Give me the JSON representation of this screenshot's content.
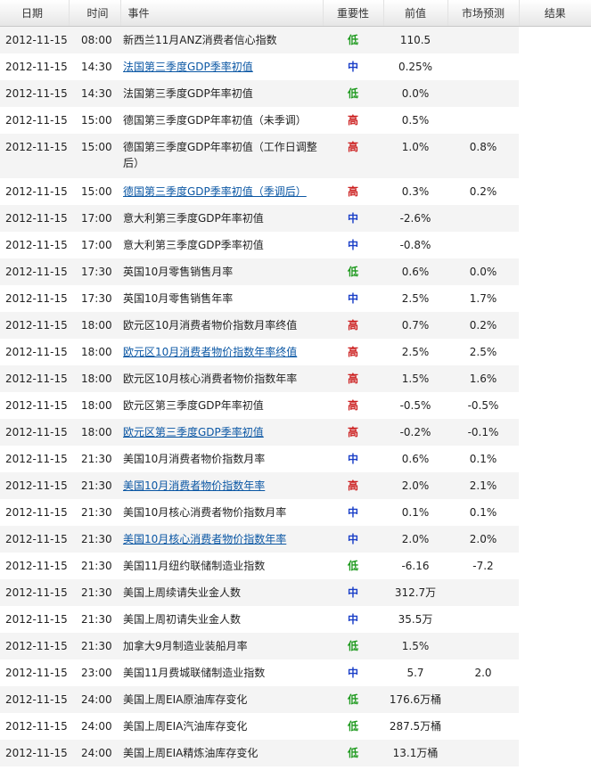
{
  "headers": [
    "日期",
    "时间",
    "事件",
    "重要性",
    "前值",
    "市场预测",
    "结果"
  ],
  "rows": [
    {
      "date": "2012-11-15",
      "time": "08:00",
      "event": "新西兰11月ANZ消费者信心指数",
      "link": false,
      "importance": "低",
      "previous": "110.5",
      "forecast": "",
      "result": ""
    },
    {
      "date": "2012-11-15",
      "time": "14:30",
      "event": "法国第三季度GDP季率初值",
      "link": true,
      "importance": "中",
      "previous": "0.25%",
      "forecast": "",
      "result": ""
    },
    {
      "date": "2012-11-15",
      "time": "14:30",
      "event": "法国第三季度GDP年率初值",
      "link": false,
      "importance": "低",
      "previous": "0.0%",
      "forecast": "",
      "result": ""
    },
    {
      "date": "2012-11-15",
      "time": "15:00",
      "event": "德国第三季度GDP年率初值（未季调）",
      "link": false,
      "importance": "高",
      "previous": "0.5%",
      "forecast": "",
      "result": ""
    },
    {
      "date": "2012-11-15",
      "time": "15:00",
      "event": "德国第三季度GDP年率初值（工作日调整后）",
      "link": false,
      "importance": "高",
      "previous": "1.0%",
      "forecast": "0.8%",
      "result": ""
    },
    {
      "date": "2012-11-15",
      "time": "15:00",
      "event": "德国第三季度GDP季率初值（季调后）",
      "link": true,
      "importance": "高",
      "previous": "0.3%",
      "forecast": "0.2%",
      "result": ""
    },
    {
      "date": "2012-11-15",
      "time": "17:00",
      "event": "意大利第三季度GDP年率初值",
      "link": false,
      "importance": "中",
      "previous": "-2.6%",
      "forecast": "",
      "result": ""
    },
    {
      "date": "2012-11-15",
      "time": "17:00",
      "event": "意大利第三季度GDP季率初值",
      "link": false,
      "importance": "中",
      "previous": "-0.8%",
      "forecast": "",
      "result": ""
    },
    {
      "date": "2012-11-15",
      "time": "17:30",
      "event": "英国10月零售销售月率",
      "link": false,
      "importance": "低",
      "previous": "0.6%",
      "forecast": "0.0%",
      "result": ""
    },
    {
      "date": "2012-11-15",
      "time": "17:30",
      "event": "英国10月零售销售年率",
      "link": false,
      "importance": "中",
      "previous": "2.5%",
      "forecast": "1.7%",
      "result": ""
    },
    {
      "date": "2012-11-15",
      "time": "18:00",
      "event": "欧元区10月消费者物价指数月率终值",
      "link": false,
      "importance": "高",
      "previous": "0.7%",
      "forecast": "0.2%",
      "result": ""
    },
    {
      "date": "2012-11-15",
      "time": "18:00",
      "event": "欧元区10月消费者物价指数年率终值",
      "link": true,
      "importance": "高",
      "previous": "2.5%",
      "forecast": "2.5%",
      "result": ""
    },
    {
      "date": "2012-11-15",
      "time": "18:00",
      "event": "欧元区10月核心消费者物价指数年率",
      "link": false,
      "importance": "高",
      "previous": "1.5%",
      "forecast": "1.6%",
      "result": ""
    },
    {
      "date": "2012-11-15",
      "time": "18:00",
      "event": "欧元区第三季度GDP年率初值",
      "link": false,
      "importance": "高",
      "previous": "-0.5%",
      "forecast": "-0.5%",
      "result": ""
    },
    {
      "date": "2012-11-15",
      "time": "18:00",
      "event": "欧元区第三季度GDP季率初值",
      "link": true,
      "importance": "高",
      "previous": "-0.2%",
      "forecast": "-0.1%",
      "result": ""
    },
    {
      "date": "2012-11-15",
      "time": "21:30",
      "event": "美国10月消费者物价指数月率",
      "link": false,
      "importance": "中",
      "previous": "0.6%",
      "forecast": "0.1%",
      "result": ""
    },
    {
      "date": "2012-11-15",
      "time": "21:30",
      "event": "美国10月消费者物价指数年率",
      "link": true,
      "importance": "高",
      "previous": "2.0%",
      "forecast": "2.1%",
      "result": ""
    },
    {
      "date": "2012-11-15",
      "time": "21:30",
      "event": "美国10月核心消费者物价指数月率",
      "link": false,
      "importance": "中",
      "previous": "0.1%",
      "forecast": "0.1%",
      "result": ""
    },
    {
      "date": "2012-11-15",
      "time": "21:30",
      "event": "美国10月核心消费者物价指数年率",
      "link": true,
      "importance": "中",
      "previous": "2.0%",
      "forecast": "2.0%",
      "result": ""
    },
    {
      "date": "2012-11-15",
      "time": "21:30",
      "event": "美国11月纽约联储制造业指数",
      "link": false,
      "importance": "低",
      "previous": "-6.16",
      "forecast": "-7.2",
      "result": ""
    },
    {
      "date": "2012-11-15",
      "time": "21:30",
      "event": "美国上周续请失业金人数",
      "link": false,
      "importance": "中",
      "previous": "312.7万",
      "forecast": "",
      "result": ""
    },
    {
      "date": "2012-11-15",
      "time": "21:30",
      "event": "美国上周初请失业金人数",
      "link": false,
      "importance": "中",
      "previous": "35.5万",
      "forecast": "",
      "result": ""
    },
    {
      "date": "2012-11-15",
      "time": "21:30",
      "event": "加拿大9月制造业装船月率",
      "link": false,
      "importance": "低",
      "previous": "1.5%",
      "forecast": "",
      "result": ""
    },
    {
      "date": "2012-11-15",
      "time": "23:00",
      "event": "美国11月费城联储制造业指数",
      "link": false,
      "importance": "中",
      "previous": "5.7",
      "forecast": "2.0",
      "result": ""
    },
    {
      "date": "2012-11-15",
      "time": "24:00",
      "event": "美国上周EIA原油库存变化",
      "link": false,
      "importance": "低",
      "previous": "176.6万桶",
      "forecast": "",
      "result": ""
    },
    {
      "date": "2012-11-15",
      "time": "24:00",
      "event": "美国上周EIA汽油库存变化",
      "link": false,
      "importance": "低",
      "previous": "287.5万桶",
      "forecast": "",
      "result": ""
    },
    {
      "date": "2012-11-15",
      "time": "24:00",
      "event": "美国上周EIA精炼油库存变化",
      "link": false,
      "importance": "低",
      "previous": "13.1万桶",
      "forecast": "",
      "result": ""
    }
  ],
  "colors": {
    "low": "#1f9a1f",
    "medium": "#1a3fc8",
    "high": "#cc1f1f",
    "link": "#0b57a4"
  }
}
